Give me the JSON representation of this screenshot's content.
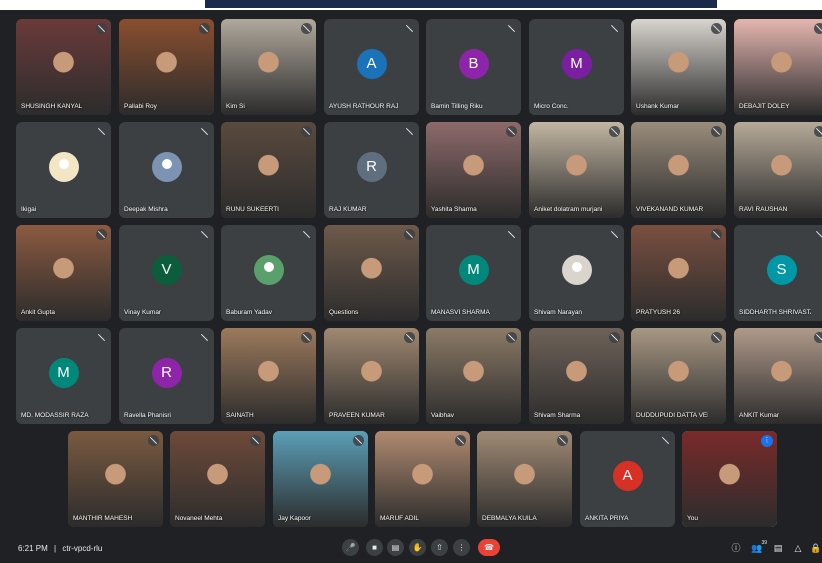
{
  "meeting": {
    "time": "6:21 PM",
    "separator": "|",
    "code": "ctr-vpcd-rlu",
    "participants_count": "39"
  },
  "colors": {
    "background": "#202124",
    "tile": "#3c4043",
    "control_button": "#3c4043",
    "end_call": "#ea4335",
    "active_speaker": "#1a73e8"
  },
  "controls": [
    {
      "name": "microphone",
      "icon": "mic-icon"
    },
    {
      "name": "camera",
      "icon": "camera-icon"
    },
    {
      "name": "captions",
      "icon": "captions-icon"
    },
    {
      "name": "raise hand",
      "icon": "hand-icon"
    },
    {
      "name": "present",
      "icon": "present-icon"
    },
    {
      "name": "more options",
      "icon": "more-vert-icon"
    },
    {
      "name": "leave call",
      "icon": "call-end-icon"
    }
  ],
  "right_controls": [
    {
      "name": "meeting info",
      "icon": "info-icon"
    },
    {
      "name": "people",
      "icon": "people-icon"
    },
    {
      "name": "chat",
      "icon": "chat-icon"
    },
    {
      "name": "activities",
      "icon": "activities-icon"
    },
    {
      "name": "host controls",
      "icon": "lock-icon"
    }
  ],
  "participants": [
    {
      "name": "SHUSINGH KANYAL",
      "type": "video",
      "bg": "#6b3a3a"
    },
    {
      "name": "Pallabi Roy",
      "type": "video",
      "bg": "#8a4e2e"
    },
    {
      "name": "Kim Si",
      "type": "video",
      "bg": "#b0a89c"
    },
    {
      "name": "AYUSH RATHOUR RAJ",
      "type": "avatar",
      "initial": "A",
      "color": "#1a73b8"
    },
    {
      "name": "Bamin Tilling Riku",
      "type": "avatar",
      "initial": "B",
      "color": "#8e24aa"
    },
    {
      "name": "Micro Conc.",
      "type": "avatar",
      "initial": "M",
      "color": "#7b1fa2"
    },
    {
      "name": "Ushank Kumar",
      "type": "video",
      "bg": "#d8d4ce"
    },
    {
      "name": "DEBAJIT DOLEY",
      "type": "video",
      "bg": "#e5b6b0"
    },
    {
      "name": "Ikigai",
      "type": "photo",
      "photo": "#f3e6c4"
    },
    {
      "name": "Deepak Mishra",
      "type": "photo",
      "photo": "#7c93b3"
    },
    {
      "name": "RUNU SUKEERTI",
      "type": "video",
      "bg": "#5a4a3e"
    },
    {
      "name": "RAJ KUMAR",
      "type": "avatar",
      "initial": "R",
      "color": "#5f6f80"
    },
    {
      "name": "Yashita Sharma",
      "type": "video",
      "bg": "#8e6a6a"
    },
    {
      "name": "Aniket dolatram murjani",
      "type": "video",
      "bg": "#c2b6a2"
    },
    {
      "name": "VIVEKANAND KUMAR",
      "type": "video",
      "bg": "#9a8d7c"
    },
    {
      "name": "RAVI RAUSHAN",
      "type": "video",
      "bg": "#b6aa98"
    },
    {
      "name": "Ankit Gupta",
      "type": "video",
      "bg": "#8c5a40"
    },
    {
      "name": "Vinay Kumar",
      "type": "avatar",
      "initial": "V",
      "color": "#0b5d3b"
    },
    {
      "name": "Baburam Yadav",
      "type": "photo",
      "photo": "#5aa06a"
    },
    {
      "name": "Questions",
      "type": "video",
      "bg": "#6d5a4a"
    },
    {
      "name": "MANASVI SHARMA",
      "type": "avatar",
      "initial": "M",
      "color": "#00897b"
    },
    {
      "name": "Shivam Narayan",
      "type": "photo",
      "photo": "#d9d4cc"
    },
    {
      "name": "PRATYUSH 26",
      "type": "video",
      "bg": "#7a5040"
    },
    {
      "name": "SIDDHARTH SHRIVASTAVA",
      "type": "avatar",
      "initial": "S",
      "color": "#0097a7"
    },
    {
      "name": "MD. MODASSIR RAZA",
      "type": "avatar",
      "initial": "M",
      "color": "#00897b"
    },
    {
      "name": "Ravella Phanisri",
      "type": "avatar",
      "initial": "R",
      "color": "#8e24aa"
    },
    {
      "name": "SAINATH",
      "type": "video",
      "bg": "#9c7a5c"
    },
    {
      "name": "PRAVEEN KUMAR",
      "type": "video",
      "bg": "#a08870"
    },
    {
      "name": "Vaibhav",
      "type": "video",
      "bg": "#8c7a66"
    },
    {
      "name": "Shivam Sharma",
      "type": "video",
      "bg": "#6e6258"
    },
    {
      "name": "DUDDUPUDI DATTA VEDESH",
      "type": "video",
      "bg": "#a89884"
    },
    {
      "name": "ANKIT Kumar",
      "type": "video",
      "bg": "#b09a8a"
    },
    {
      "name": "MANTHIR MAHESH",
      "type": "video",
      "bg": "#7a5a40"
    },
    {
      "name": "Novaneel Mehta",
      "type": "video",
      "bg": "#6e4a3a"
    },
    {
      "name": "Jay Kapoor",
      "type": "video",
      "bg": "#5b9fb7"
    },
    {
      "name": "MARUF ADIL",
      "type": "video",
      "bg": "#b08a70"
    },
    {
      "name": "DEBMALYA KUILA",
      "type": "video",
      "bg": "#a08a74"
    },
    {
      "name": "ANKITA PRIYA",
      "type": "avatar",
      "initial": "A",
      "color": "#d93025"
    },
    {
      "name": "You",
      "type": "you",
      "bg": "#7a2a2a"
    }
  ]
}
